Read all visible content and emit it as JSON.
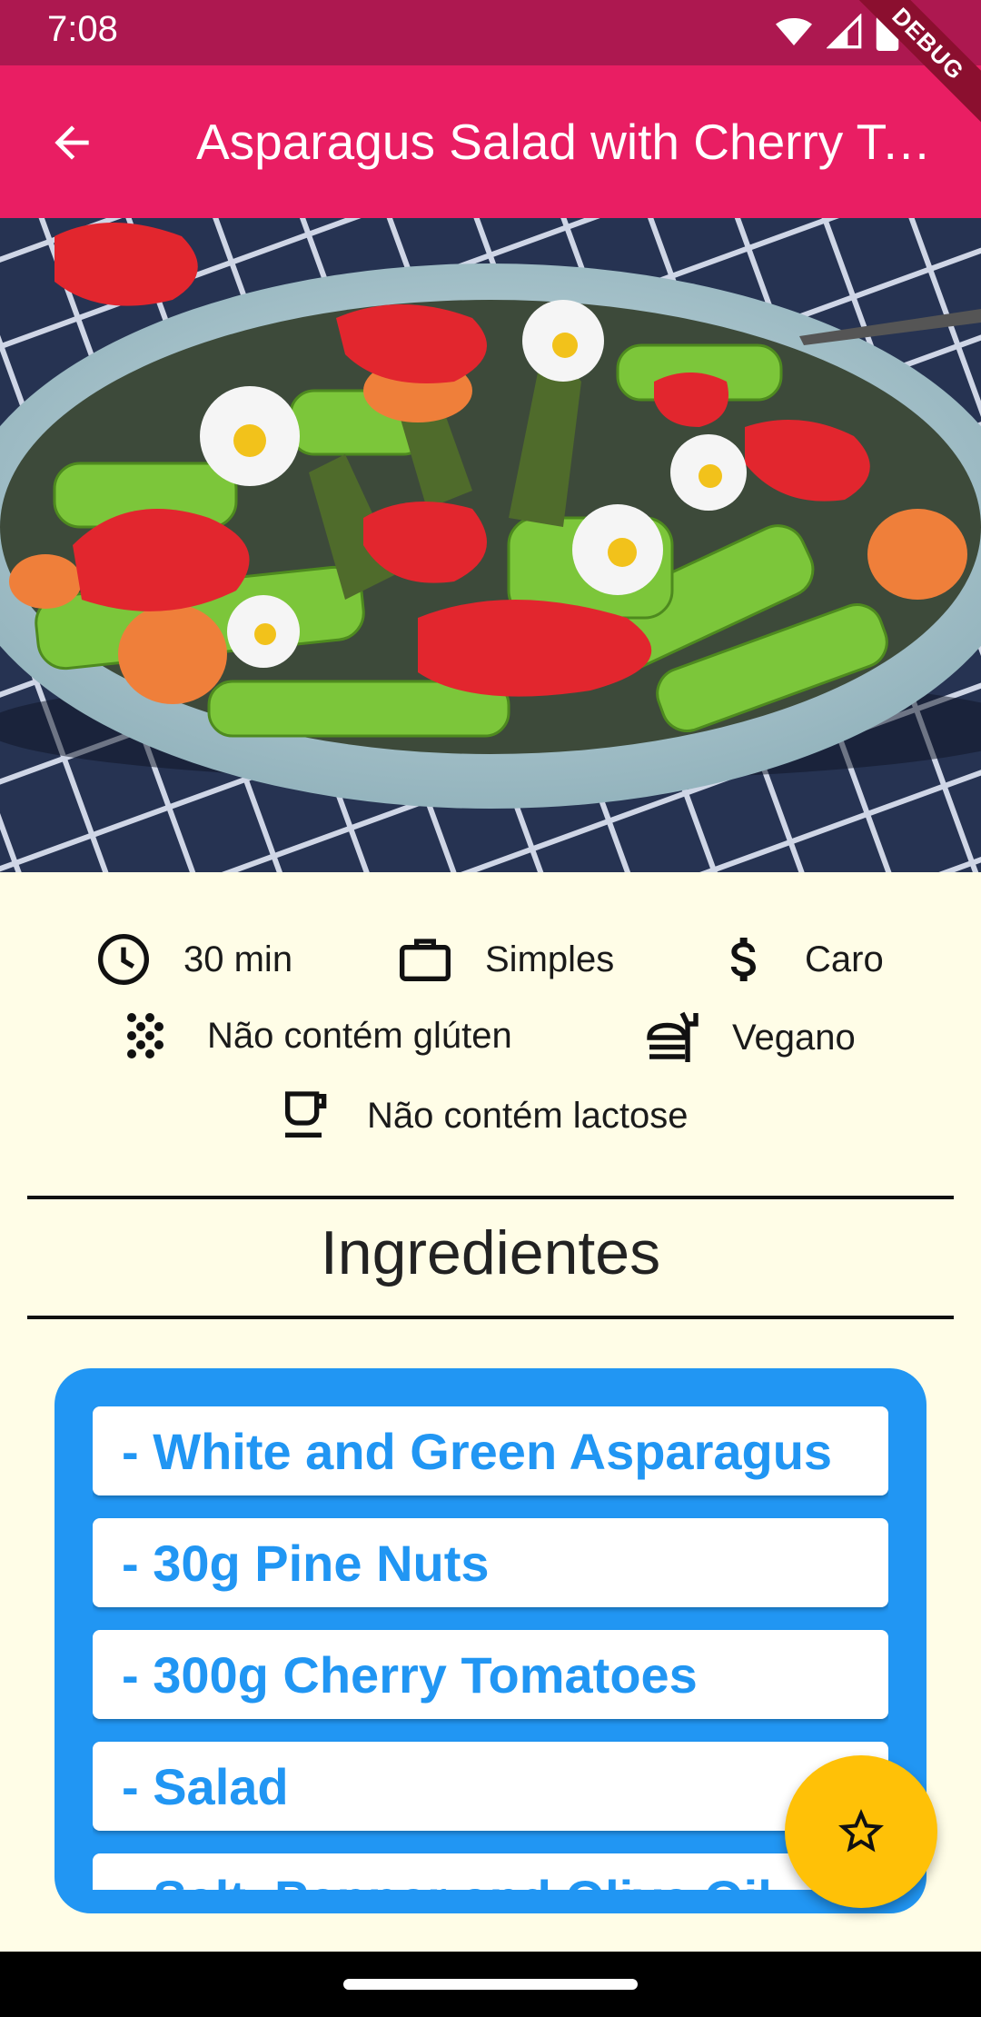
{
  "status_bar": {
    "time": "7:08",
    "icons": [
      "wifi-icon",
      "signal-icon",
      "battery-icon"
    ],
    "debug_label": "DEBUG"
  },
  "app_bar": {
    "title": "Asparagus Salad with Cherry Tomatoes",
    "back_icon": "arrow-back-icon",
    "background": "#E91E63"
  },
  "hero_image": {
    "description_icon": "salad-photo"
  },
  "meal_info": {
    "duration": "30 min",
    "complexity": "Simples",
    "affordability": "Caro",
    "gluten": "Não contém glúten",
    "vegan": "Vegano",
    "lactose": "Não contém lactose"
  },
  "ingredients": {
    "title": "Ingredientes",
    "items": [
      "- White and Green Asparagus",
      "- 30g Pine Nuts",
      "- 300g Cherry Tomatoes",
      "- Salad",
      "- Salt, Pepper and Olive Oil"
    ]
  },
  "fab": {
    "icon": "star-outline-icon",
    "color": "#FFC107"
  },
  "colors": {
    "status_bar": "#AD1850",
    "background": "#FFFDE7",
    "card": "#2196F3"
  }
}
